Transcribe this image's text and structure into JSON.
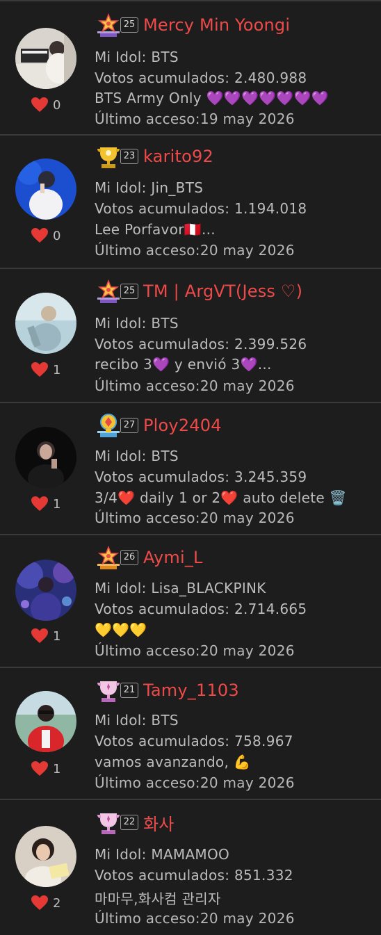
{
  "users": [
    {
      "username": "Mercy Min Yoongi",
      "level": "25",
      "badge_icon": "star-trophy-badge",
      "idol": "Mi Idol: BTS",
      "votes": "Votos acumulados: 2.480.988",
      "status": "BTS Army Only 💜💜💜💜💜💜💜",
      "last_access": "Último acceso:19 may 2026",
      "likes": "0",
      "avatar": "photo-person-piano"
    },
    {
      "username": "karito92",
      "level": "23",
      "badge_icon": "gold-trophy-badge",
      "idol": "Mi Idol: Jin_BTS",
      "votes": "Votos acumulados: 1.194.018",
      "status": "Lee Porfavor🇵🇪...",
      "last_access": "Último acceso:20 may 2026",
      "likes": "0",
      "avatar": "photo-singer-blue"
    },
    {
      "username": "TM | ArgVT(Jess ♡)",
      "level": "25",
      "badge_icon": "star-trophy-badge",
      "idol": "Mi Idol: BTS",
      "votes": "Votos acumulados: 2.399.526",
      "status": "recibo 3💜 y envió 3💜...",
      "last_access": "Último acceso:20 may 2026",
      "likes": "1",
      "avatar": "photo-person-light"
    },
    {
      "username": "Ploy2404",
      "level": "27",
      "badge_icon": "diamond-trophy-badge",
      "idol": "Mi Idol: BTS",
      "votes": "Votos acumulados: 3.245.359",
      "status": "3/4❤️ daily 1 or 2❤️ auto delete 🗑️",
      "last_access": "Último acceso:20 may 2026",
      "likes": "1",
      "avatar": "photo-person-dark"
    },
    {
      "username": "Aymi_L",
      "level": "26",
      "badge_icon": "star-trophy-badge",
      "idol": "Mi Idol: Lisa_BLACKPINK",
      "votes": "Votos acumulados: 2.714.665",
      "status": "💛💛💛",
      "last_access": "Último acceso:20 may 2026",
      "likes": "1",
      "avatar": "photo-person-purple"
    },
    {
      "username": "Tamy_1103",
      "level": "21",
      "badge_icon": "pink-trophy-badge",
      "idol": "Mi Idol: BTS",
      "votes": "Votos acumulados: 758.967",
      "status": "vamos avanzando, 💪",
      "last_access": "Último acceso:20 may 2026",
      "likes": "1",
      "avatar": "photo-person-red-jacket"
    },
    {
      "username": "화사",
      "level": "22",
      "badge_icon": "pink-trophy-badge",
      "idol": "Mi Idol: MAMAMOO",
      "votes": "Votos acumulados: 851.332",
      "status": "마마무,화사컴 관리자",
      "last_access": "Último acceso:20 may 2026",
      "likes": "2",
      "avatar": "photo-person-smiling"
    }
  ],
  "colors": {
    "background": "#1d1d1d",
    "divider": "#3a3a3a",
    "username": "#ef4a4a",
    "text": "#bdbdbd",
    "heart": "#e53935"
  }
}
